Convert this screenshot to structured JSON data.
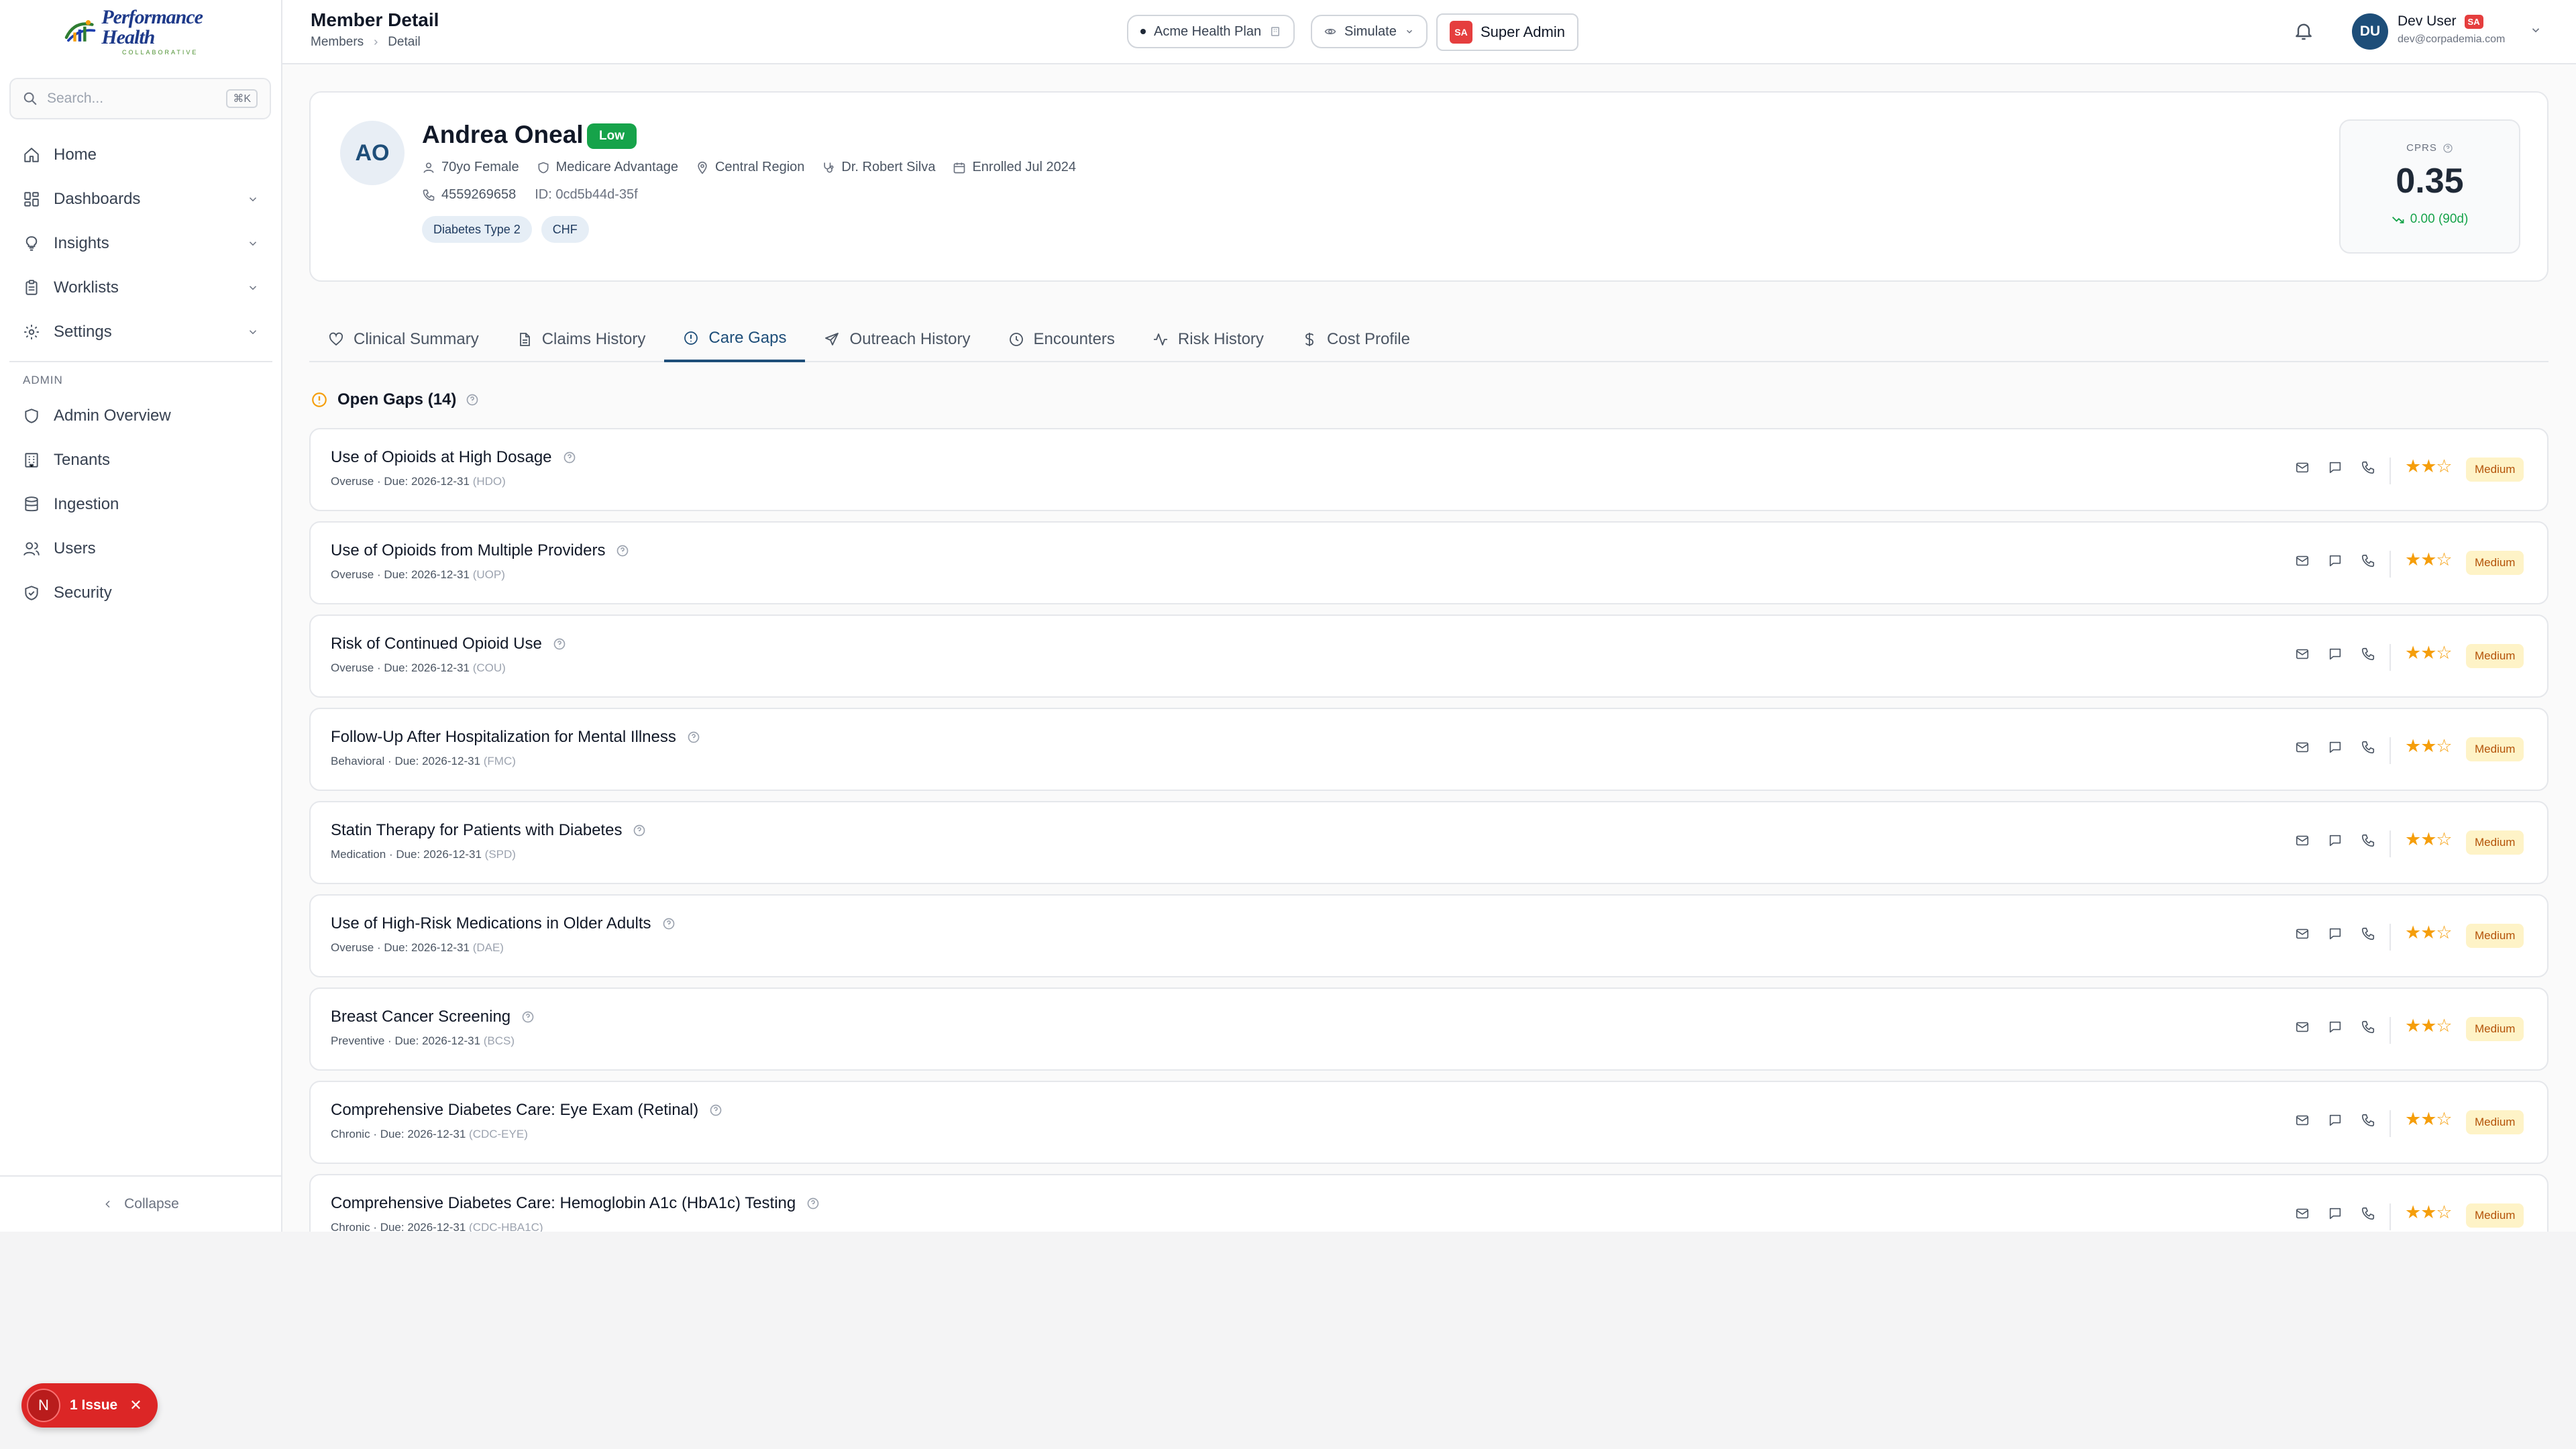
{
  "brand": {
    "name": "Performance Health",
    "tagline": "COLLABORATIVE"
  },
  "sidebar": {
    "search_placeholder": "Search...",
    "search_shortcut": "⌘K",
    "items": [
      {
        "label": "Home",
        "icon": "home-icon"
      },
      {
        "label": "Dashboards",
        "icon": "dashboard-icon"
      },
      {
        "label": "Insights",
        "icon": "lightbulb-icon"
      },
      {
        "label": "Worklists",
        "icon": "clipboard-icon"
      },
      {
        "label": "Settings",
        "icon": "gear-icon"
      }
    ],
    "admin_section_label": "ADMIN",
    "admin_items": [
      {
        "label": "Admin Overview",
        "icon": "shield-icon"
      },
      {
        "label": "Tenants",
        "icon": "building-icon"
      },
      {
        "label": "Ingestion",
        "icon": "database-icon"
      },
      {
        "label": "Users",
        "icon": "users-icon"
      },
      {
        "label": "Security",
        "icon": "shield-check-icon"
      }
    ],
    "collapse_label": "Collapse"
  },
  "header": {
    "title": "Member Detail",
    "breadcrumb": [
      "Members",
      "Detail"
    ],
    "plan_label": "Acme Health Plan",
    "simulate_label": "Simulate",
    "role_chip": "SA",
    "role_label": "Super Admin",
    "user": {
      "initials": "DU",
      "name": "Dev User",
      "badge": "SA",
      "email": "dev@corpademia.com"
    }
  },
  "member": {
    "initials": "AO",
    "name": "Andrea Oneal",
    "risk_level": "Low",
    "age_gender": "70yo Female",
    "plan": "Medicare Advantage",
    "region": "Central Region",
    "provider": "Dr. Robert Silva",
    "enrolled": "Enrolled Jul 2024",
    "phone": "4559269658",
    "id": "ID: 0cd5b44d-35f",
    "conditions": [
      "Diabetes Type 2",
      "CHF"
    ],
    "cprs": {
      "label": "CPRS",
      "value": "0.35",
      "delta": "0.00 (90d)"
    }
  },
  "tabs": [
    {
      "label": "Clinical Summary",
      "icon": "heart-icon",
      "active": false
    },
    {
      "label": "Claims History",
      "icon": "document-icon",
      "active": false
    },
    {
      "label": "Care Gaps",
      "icon": "alert-circle-icon",
      "active": true
    },
    {
      "label": "Outreach History",
      "icon": "send-icon",
      "active": false
    },
    {
      "label": "Encounters",
      "icon": "clock-icon",
      "active": false
    },
    {
      "label": "Risk History",
      "icon": "activity-icon",
      "active": false
    },
    {
      "label": "Cost Profile",
      "icon": "dollar-icon",
      "active": false
    }
  ],
  "open_gaps": {
    "heading": "Open Gaps (14)",
    "items": [
      {
        "title": "Use of Opioids at High Dosage",
        "category": "Overuse",
        "due": "Due: 2026-12-31",
        "code": "(HDO)",
        "stars": 2,
        "priority": "Medium"
      },
      {
        "title": "Use of Opioids from Multiple Providers",
        "category": "Overuse",
        "due": "Due: 2026-12-31",
        "code": "(UOP)",
        "stars": 2,
        "priority": "Medium"
      },
      {
        "title": "Risk of Continued Opioid Use",
        "category": "Overuse",
        "due": "Due: 2026-12-31",
        "code": "(COU)",
        "stars": 2,
        "priority": "Medium"
      },
      {
        "title": "Follow-Up After Hospitalization for Mental Illness",
        "category": "Behavioral",
        "due": "Due: 2026-12-31",
        "code": "(FMC)",
        "stars": 2,
        "priority": "Medium"
      },
      {
        "title": "Statin Therapy for Patients with Diabetes",
        "category": "Medication",
        "due": "Due: 2026-12-31",
        "code": "(SPD)",
        "stars": 2,
        "priority": "Medium"
      },
      {
        "title": "Use of High-Risk Medications in Older Adults",
        "category": "Overuse",
        "due": "Due: 2026-12-31",
        "code": "(DAE)",
        "stars": 2,
        "priority": "Medium"
      },
      {
        "title": "Breast Cancer Screening",
        "category": "Preventive",
        "due": "Due: 2026-12-31",
        "code": "(BCS)",
        "stars": 2,
        "priority": "Medium"
      },
      {
        "title": "Comprehensive Diabetes Care: Eye Exam (Retinal)",
        "category": "Chronic",
        "due": "Due: 2026-12-31",
        "code": "(CDC-EYE)",
        "stars": 2,
        "priority": "Medium"
      },
      {
        "title": "Comprehensive Diabetes Care: Hemoglobin A1c (HbA1c) Testing",
        "category": "Chronic",
        "due": "Due: 2026-12-31",
        "code": "(CDC-HBA1C)",
        "stars": 2,
        "priority": "Medium"
      }
    ]
  },
  "issue_toast": {
    "initial": "N",
    "label": "1 Issue"
  },
  "colors": {
    "accent": "#1e4e79",
    "risk_low": "#16a34a",
    "priority_medium_bg": "#fef3c7",
    "star": "#f59e0b",
    "issue_red": "#dc2626"
  }
}
